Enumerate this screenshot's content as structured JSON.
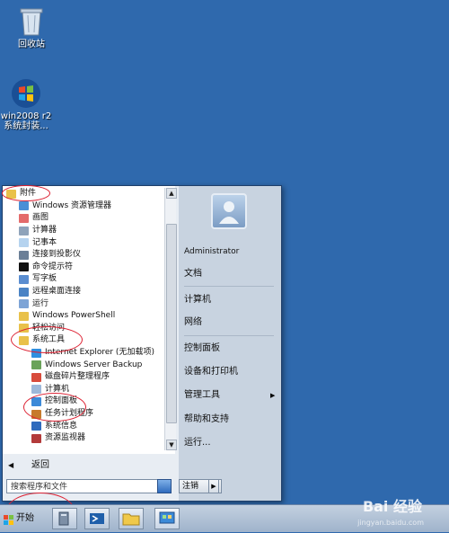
{
  "desktop": {
    "icons": [
      {
        "label": "回收站"
      },
      {
        "label": "win2008 r2\n系统封装..."
      }
    ]
  },
  "start_menu": {
    "programs": [
      {
        "label": "附件",
        "icon": "folder-icon"
      },
      {
        "label": "Windows 资源管理器",
        "icon": "explorer-icon"
      },
      {
        "label": "画图",
        "icon": "paint-icon"
      },
      {
        "label": "计算器",
        "icon": "calculator-icon"
      },
      {
        "label": "记事本",
        "icon": "notepad-icon"
      },
      {
        "label": "连接到投影仪",
        "icon": "projector-icon"
      },
      {
        "label": "命令提示符",
        "icon": "cmd-icon"
      },
      {
        "label": "写字板",
        "icon": "wordpad-icon"
      },
      {
        "label": "远程桌面连接",
        "icon": "remote-desktop-icon"
      },
      {
        "label": "运行",
        "icon": "run-icon"
      },
      {
        "label": "Windows PowerShell",
        "icon": "folder-icon"
      },
      {
        "label": "轻松访问",
        "icon": "folder-icon"
      },
      {
        "label": "系统工具",
        "icon": "folder-icon"
      },
      {
        "label": "Internet Explorer (无加载项)",
        "icon": "ie-icon"
      },
      {
        "label": "Windows Server Backup",
        "icon": "backup-icon"
      },
      {
        "label": "磁盘碎片整理程序",
        "icon": "defrag-icon"
      },
      {
        "label": "计算机",
        "icon": "computer-icon"
      },
      {
        "label": "控制面板",
        "icon": "control-panel-icon"
      },
      {
        "label": "任务计划程序",
        "icon": "task-scheduler-icon"
      },
      {
        "label": "系统信息",
        "icon": "sysinfo-icon"
      },
      {
        "label": "资源监视器",
        "icon": "resource-monitor-icon"
      }
    ],
    "back_label": "返回",
    "search_placeholder": "搜索程序和文件",
    "right_items": [
      {
        "label": "Administrator"
      },
      {
        "label": "文档"
      },
      {
        "label": "计算机"
      },
      {
        "label": "网络"
      },
      {
        "label": "控制面板"
      },
      {
        "label": "设备和打印机"
      },
      {
        "label": "管理工具"
      },
      {
        "label": "帮助和支持"
      },
      {
        "label": "运行..."
      }
    ],
    "logoff_label": "注销"
  },
  "taskbar": {
    "start_label": "开始"
  },
  "watermark": {
    "brand": "Bai 经验",
    "url": "jingyan.baidu.com"
  }
}
